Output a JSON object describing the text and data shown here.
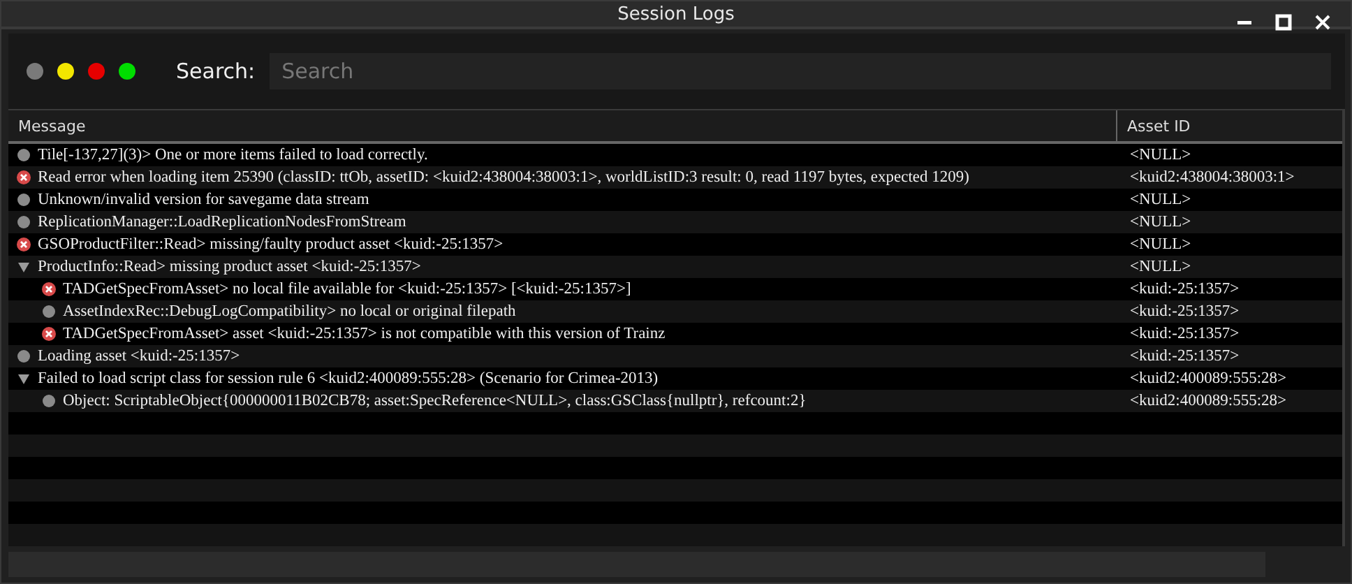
{
  "window": {
    "title": "Session Logs"
  },
  "filters": [
    {
      "color": "#7a7a7a"
    },
    {
      "color": "#f2e600"
    },
    {
      "color": "#e60000"
    },
    {
      "color": "#00dd00"
    }
  ],
  "search": {
    "label": "Search:",
    "placeholder": "Search"
  },
  "table": {
    "columns": [
      "Message",
      "Asset ID"
    ],
    "rows": [
      {
        "kind": "info",
        "message": "Tile[-137,27](3)> One or more items failed to load correctly.",
        "asset": "<NULL>"
      },
      {
        "kind": "error",
        "message": "Read error when loading item 25390 (classID: ttOb, assetID: <kuid2:438004:38003:1>, worldListID:3 result: 0, read 1197 bytes, expected 1209)",
        "asset": "<kuid2:438004:38003:1>"
      },
      {
        "kind": "info",
        "message": "Unknown/invalid version for savegame data stream",
        "asset": "<NULL>"
      },
      {
        "kind": "info",
        "message": "ReplicationManager::LoadReplicationNodesFromStream",
        "asset": "<NULL>"
      },
      {
        "kind": "error",
        "message": "GSOProductFilter::Read> missing/faulty product asset <kuid:-25:1357>",
        "asset": "<NULL>"
      },
      {
        "kind": "group",
        "expanded": true,
        "message": "ProductInfo::Read> missing product asset <kuid:-25:1357>",
        "asset": "<NULL>",
        "children": [
          {
            "kind": "error",
            "message": "TADGetSpecFromAsset> no local file available for <kuid:-25:1357> [<kuid:-25:1357>]",
            "asset": "<kuid:-25:1357>"
          },
          {
            "kind": "info",
            "message": "AssetIndexRec::DebugLogCompatibility> no local or original filepath",
            "asset": "<kuid:-25:1357>"
          },
          {
            "kind": "error",
            "message": "TADGetSpecFromAsset> asset <kuid:-25:1357> is not compatible with this version of Trainz",
            "asset": "<kuid:-25:1357>"
          }
        ]
      },
      {
        "kind": "info",
        "message": "Loading asset <kuid:-25:1357>",
        "asset": "<kuid:-25:1357>"
      },
      {
        "kind": "group",
        "expanded": true,
        "message": "Failed to load script class for session rule 6 <kuid2:400089:555:28> (Scenario for Crimea-2013)",
        "asset": "<kuid2:400089:555:28>",
        "children": [
          {
            "kind": "info",
            "message": "Object: ScriptableObject{000000011B02CB78; asset:SpecReference<NULL>, class:GSClass{nullptr}, refcount:2}",
            "asset": "<kuid2:400089:555:28>"
          }
        ]
      }
    ]
  }
}
